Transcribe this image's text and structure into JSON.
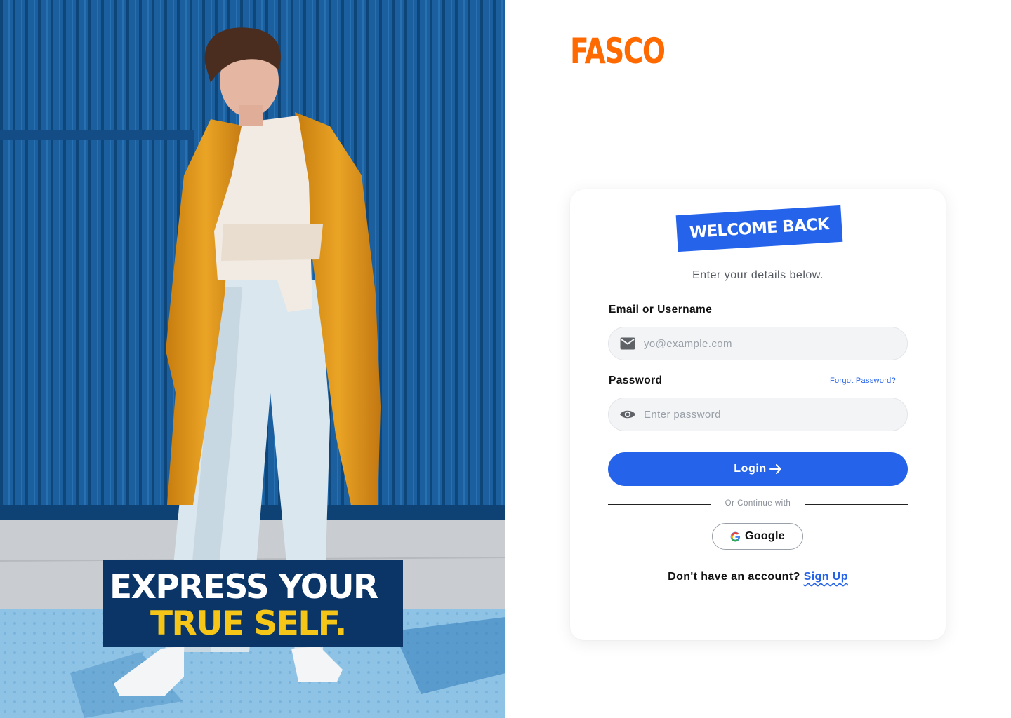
{
  "hero": {
    "slogan_line1": "EXPRESS YOUR",
    "slogan_line2": "TRUE SELF.",
    "colors": {
      "wall": "#1a5c99",
      "coat": "#e59a1c",
      "slogan_bg": "#0a3566",
      "slogan_accent": "#f5c518"
    }
  },
  "brand": {
    "name": "FASCO",
    "color": "#ff6a00"
  },
  "card": {
    "badge": "WELCOME BACK",
    "subtitle": "Enter your details below.",
    "email": {
      "label": "Email or Username",
      "placeholder": "yo@example.com",
      "value": "",
      "icon": "mail-icon"
    },
    "password": {
      "label": "Password",
      "placeholder": "Enter password",
      "value": "",
      "icon": "eye-icon",
      "forgot": "Forgot Password?"
    },
    "login_label": "Login",
    "divider_text": "Or Continue with",
    "google_label": "Google",
    "signup_prompt": "Don't have an account?",
    "signup_link": "Sign Up",
    "accent": "#2563eb"
  }
}
